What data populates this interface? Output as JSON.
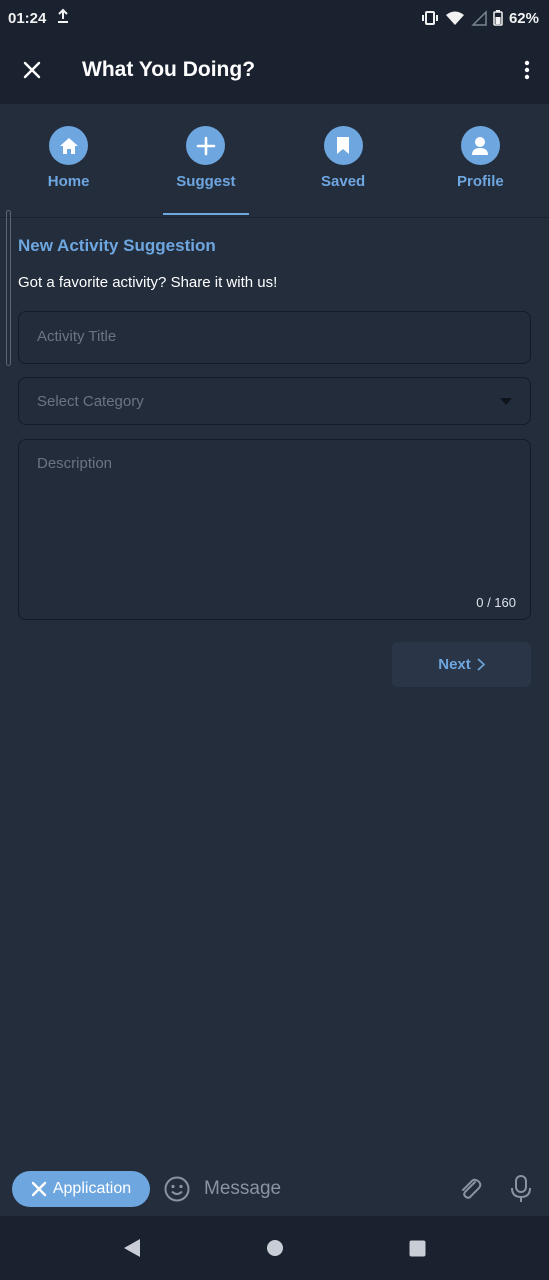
{
  "status": {
    "time": "01:24",
    "battery": "62%"
  },
  "app": {
    "title": "What You Doing?"
  },
  "tabs": [
    {
      "label": "Home",
      "icon": "home-icon"
    },
    {
      "label": "Suggest",
      "icon": "plus-icon",
      "active": true
    },
    {
      "label": "Saved",
      "icon": "bookmark-icon"
    },
    {
      "label": "Profile",
      "icon": "person-icon"
    }
  ],
  "form": {
    "heading": "New Activity Suggestion",
    "subheading": "Got a favorite activity? Share it with us!",
    "title_placeholder": "Activity Title",
    "category_placeholder": "Select Category",
    "description_placeholder": "Description",
    "counter": "0 / 160",
    "next_label": "Next"
  },
  "chat": {
    "chip_label": "Application",
    "message_placeholder": "Message"
  },
  "colors": {
    "accent": "#6ea6e0",
    "background": "#232d3c",
    "bar": "#1a2230"
  }
}
